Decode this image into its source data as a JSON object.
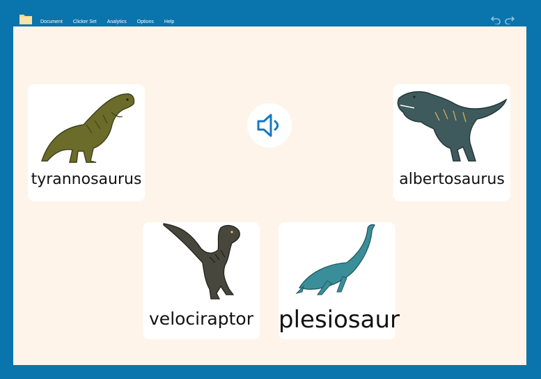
{
  "menu": {
    "items": [
      "Document",
      "Clicker Set",
      "Analytics",
      "Options",
      "Help"
    ]
  },
  "cards": {
    "tyrannosaurus": "tyrannosaurus",
    "albertosaurus": "albertosaurus",
    "velociraptor": "velociraptor",
    "plesiosaur": "plesiosaur"
  },
  "icons": {
    "folder": "folder-icon",
    "undo": "undo-icon",
    "redo": "redo-icon",
    "speaker": "speaker-icon"
  },
  "colors": {
    "frame": "#0a74ad",
    "canvas": "#fef4ea",
    "card": "#ffffff",
    "speaker_icon": "#1478c2"
  }
}
